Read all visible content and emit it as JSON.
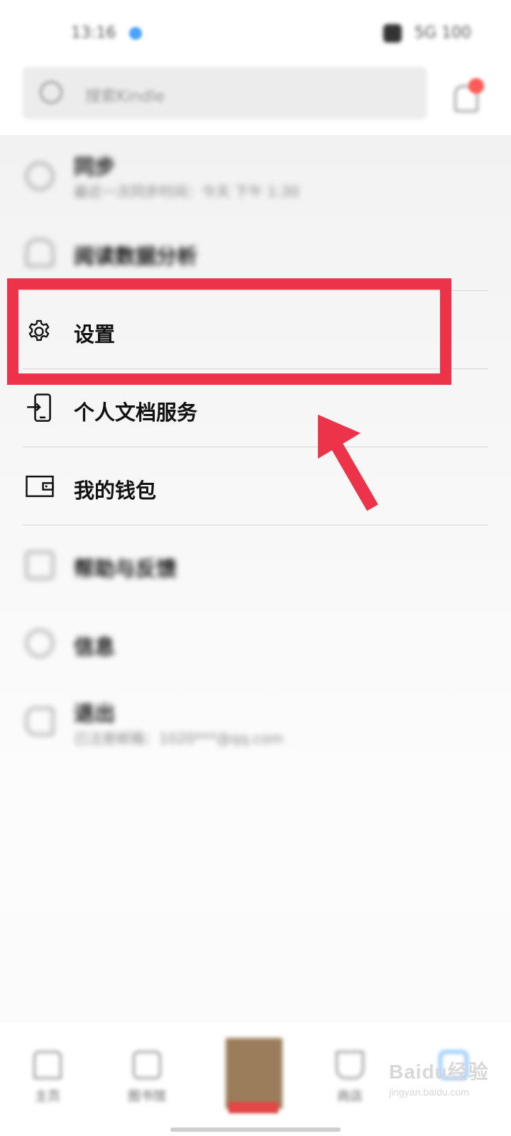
{
  "menu": {
    "items": [
      {
        "key": "sync",
        "label": "同步",
        "sub": "最近一次同步时间：今天 下午 1:30",
        "blurred": true,
        "icon": "sync-icon"
      },
      {
        "key": "reading-insights",
        "label": "阅读数据分析",
        "sub": "",
        "blurred": true,
        "icon": "chart-icon"
      },
      {
        "key": "settings",
        "label": "设置",
        "sub": "",
        "blurred": false,
        "icon": "gear-icon"
      },
      {
        "key": "personal-docs",
        "label": "个人文档服务",
        "sub": "",
        "blurred": false,
        "icon": "doc-transfer-icon"
      },
      {
        "key": "wallet",
        "label": "我的钱包",
        "sub": "",
        "blurred": false,
        "icon": "wallet-icon"
      },
      {
        "key": "help",
        "label": "帮助与反馈",
        "sub": "",
        "blurred": true,
        "icon": "help-icon"
      },
      {
        "key": "info",
        "label": "信息",
        "sub": "",
        "blurred": true,
        "icon": "info-icon"
      },
      {
        "key": "logout",
        "label": "退出",
        "sub": "已注册邮箱：1020***@qq.com",
        "blurred": true,
        "icon": "logout-icon"
      }
    ]
  },
  "header": {
    "search_placeholder": "搜索Kindle"
  },
  "status_bar": {
    "time": "13:16",
    "right": "5G 100"
  },
  "bottom_nav": {
    "items": [
      {
        "label": "主页",
        "icon": "home-icon"
      },
      {
        "label": "图书馆",
        "icon": "library-icon"
      },
      {
        "label": "",
        "icon": "book-cover"
      },
      {
        "label": "商店",
        "icon": "cart-icon"
      },
      {
        "label": "",
        "icon": "more-icon"
      }
    ]
  },
  "watermark": {
    "main": "Baidu经验",
    "sub": "jingyan.baidu.com"
  },
  "colors": {
    "highlight": "#ec3349",
    "divider": "#d6d6d6"
  }
}
